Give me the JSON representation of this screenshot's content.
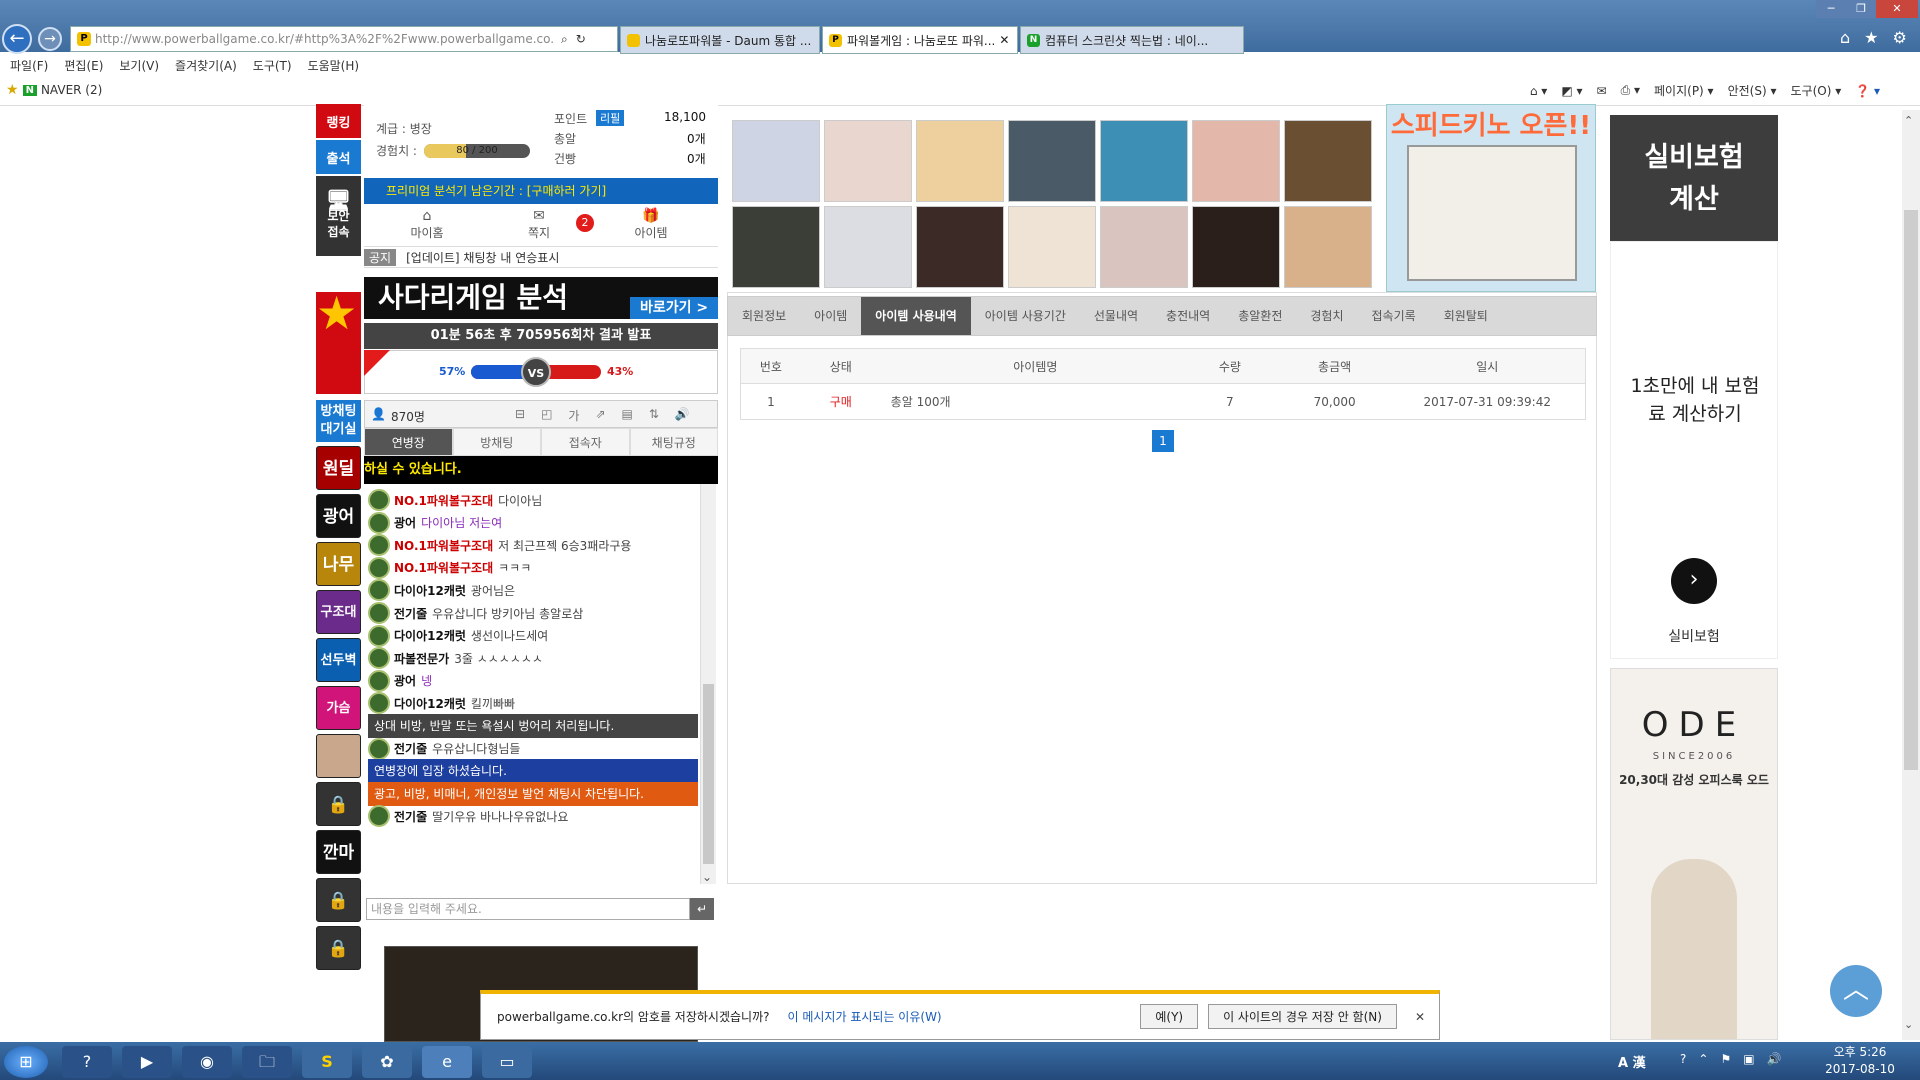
{
  "browser": {
    "address": "http://www.powerballgame.co.kr/#http%3A%2F%2Fwww.powerballgame.co.kr%2F%3I",
    "address_host": "powerballgame.co.kr",
    "tabs": [
      {
        "label": "나눔로또파워볼 - Daum 통합 ...",
        "icon_color": "#f2c200"
      },
      {
        "label": "파워볼게임 : 나눔로또 파워...",
        "icon_color": "#f2c200"
      },
      {
        "label": "컴퓨터 스크린샷 찍는법 : 네이...",
        "icon_color": "#19a12c"
      }
    ],
    "menu": [
      "파일(F)",
      "편집(E)",
      "보기(V)",
      "즐겨찾기(A)",
      "도구(T)",
      "도움말(H)"
    ],
    "fav": "NAVER (2)",
    "tools": [
      "페이지(P) ▾",
      "안전(S) ▾",
      "도구(O) ▾"
    ]
  },
  "left_strip": {
    "rank": "랭킹",
    "attend": "출석",
    "secure": "보안\n접속",
    "waiting": "방채팅\n대기실",
    "thumbs": [
      "원딜이",
      "광어",
      "나무",
      "구조대",
      "선두벽",
      "가슴",
      "",
      "",
      "깐마",
      "",
      ""
    ]
  },
  "profile": {
    "grade": "계급 : 병장",
    "exp_label": "경험치 :",
    "exp_value": "80 / 200",
    "exp_ratio": 0.4,
    "point_label": "포인트",
    "point_tag": "리필",
    "point_value": "18,100",
    "bullet_label": "총알",
    "bullet_value": "0개",
    "gun_label": "건빵",
    "gun_value": "0개",
    "premium": "프리미엄 분석기 남은기간 : [구매하러 가기]",
    "menu": [
      "마이홈",
      "쪽지",
      "아이템"
    ],
    "note_count": "2",
    "notice_tag": "공지",
    "notice": "[업데이트] 채팅창 내 연승표시"
  },
  "ladder": {
    "title": "사다리게임 분석",
    "go": "바로가기 >",
    "timer": "01분 56초 후 705956회차 결과 발표",
    "left_pct": "57%",
    "right_pct": "43%",
    "left_ratio": 0.57,
    "vs": "VS"
  },
  "chat": {
    "users": "870명",
    "tabs": [
      "연병장",
      "방채팅",
      "접속자",
      "채팅규정"
    ],
    "notice": "하실 수 있습니다.",
    "input_placeholder": "내용을 입력해 주세요.",
    "lines": [
      {
        "type": "msg",
        "name": "NO.1파워볼구조대",
        "red": true,
        "msg": "다이아님"
      },
      {
        "type": "msg",
        "name": "광어",
        "msg": "다이아님 저는여",
        "purple": true
      },
      {
        "type": "msg",
        "name": "NO.1파워볼구조대",
        "red": true,
        "msg": "저 최근프젝 6승3패라구용"
      },
      {
        "type": "msg",
        "name": "NO.1파워볼구조대",
        "red": true,
        "msg": "ㅋㅋㅋ"
      },
      {
        "type": "msg",
        "name": "다이아12캐럿",
        "msg": "광어님은"
      },
      {
        "type": "msg",
        "name": "전기줄",
        "msg": "우유삽니다 방키아님 총알로삼"
      },
      {
        "type": "msg",
        "name": "다이아12캐럿",
        "msg": "생선이나드세여"
      },
      {
        "type": "msg",
        "name": "파볼전문가",
        "msg": "3줄 ㅅㅅㅅㅅㅅㅅ"
      },
      {
        "type": "msg",
        "name": "광어",
        "msg": "넹",
        "purple": true
      },
      {
        "type": "msg",
        "name": "다이아12캐럿",
        "msg": "킬끼빠빠"
      },
      {
        "type": "sys",
        "bg": "#444",
        "msg": "상대 비방, 반말 또는 욕설시 벙어리 처리됩니다."
      },
      {
        "type": "msg",
        "name": "전기줄",
        "msg": "우유삽니다형님들"
      },
      {
        "type": "sys",
        "bg": "#1d3fa0",
        "msg": "연병장에 입장 하셨습니다."
      },
      {
        "type": "sys",
        "bg": "#e05a12",
        "msg": "광고, 비방, 비매너, 개인정보 발언 채팅시 차단됩니다."
      },
      {
        "type": "msg",
        "name": "전기줄",
        "msg": "딸기우유 바나나우유없나요"
      }
    ]
  },
  "member_tabs": [
    "회원정보",
    "아이템",
    "아이템 사용내역",
    "아이템 사용기간",
    "선물내역",
    "충전내역",
    "총알환전",
    "경험치",
    "접속기록",
    "회원탈퇴"
  ],
  "table": {
    "headers": [
      "번호",
      "상태",
      "아이템명",
      "수량",
      "총금액",
      "일시"
    ],
    "rows": [
      {
        "no": "1",
        "status": "구매",
        "item": "총알 100개",
        "qty": "7",
        "amount": "70,000",
        "date": "2017-07-31 09:39:42"
      }
    ]
  },
  "pager": "1",
  "ads": {
    "top_banner": "스피드키노 오픈!!",
    "insurance_title": "실비보험\n계산",
    "insurance_body": "1초만에 내 보험료 계산하기",
    "insurance_link": "실비보험",
    "ode_brand": "ODE",
    "ode_since": "SINCE2006",
    "ode_tag": "20,30대 감성 오피스룩 오드"
  },
  "password_bar": {
    "text": "powerballgame.co.kr의 암호를 저장하시겠습니까?",
    "link": "이 메시지가 표시되는 이유(W)",
    "yes": "예(Y)",
    "never": "이 사이트의 경우 저장 안 함(N)"
  },
  "taskbar": {
    "ime": "A 漢",
    "time": "오후 5:26",
    "date": "2017-08-10"
  }
}
